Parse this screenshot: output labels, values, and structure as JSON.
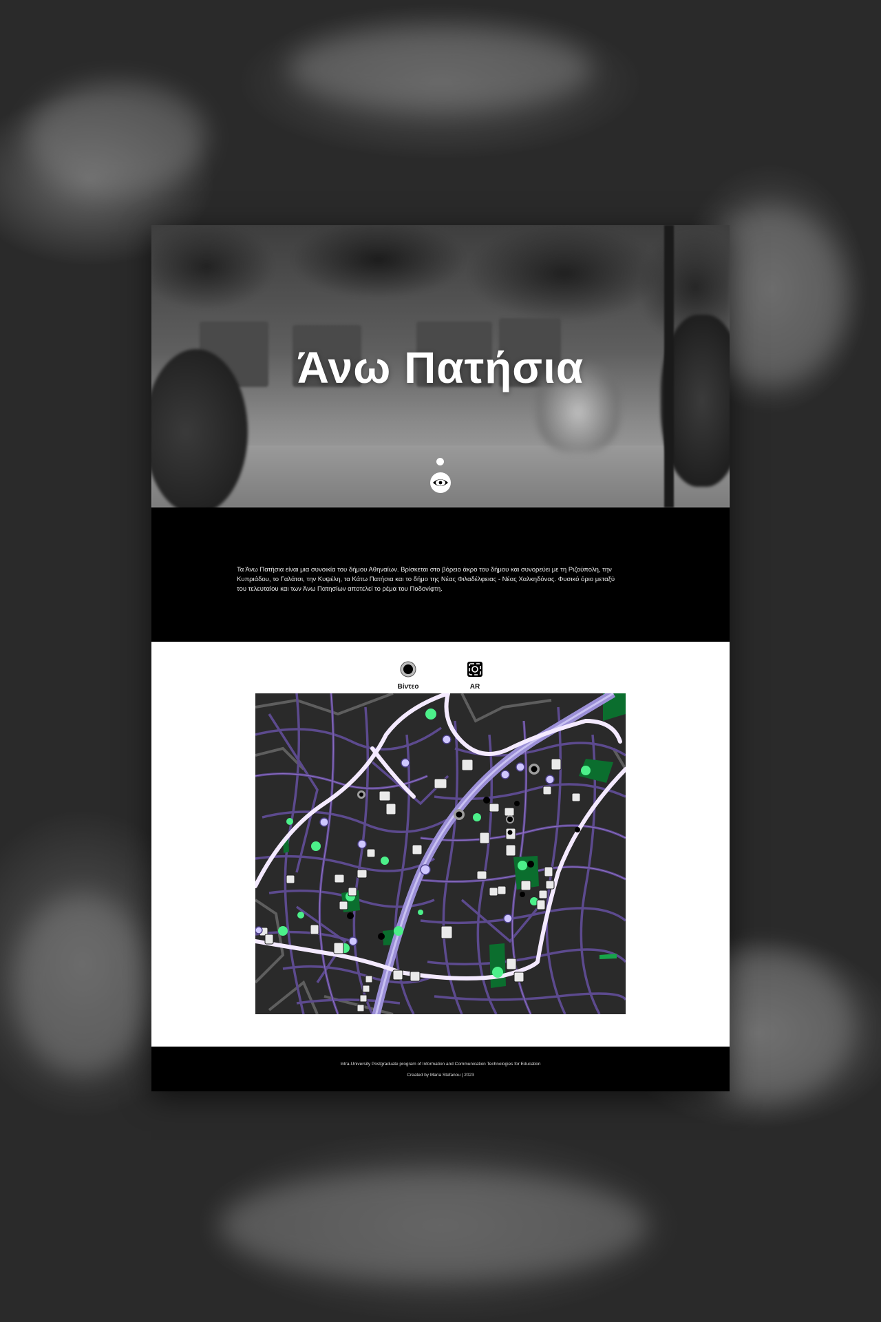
{
  "hero": {
    "title": "Άνω Πατήσια",
    "scroll_icon": "eye-icon"
  },
  "intro": {
    "text": "Τα Άνω Πατήσια είναι μια συνοικία του δήμου Αθηναίων. Βρίσκεται στο βόρειο άκρο του δήμου και συνορεύει με τη Ριζούπολη, την Κυπριάδου, το Γαλάτσι, την Κυψέλη, τα Κάτω Πατήσια και το δήμο της Νέας Φιλαδέλφειας - Νέας Χαλκηδόνας. Φυσικό όριο μεταξύ του τελευταίου και των Άνω Πατησίων αποτελεί το ρέμα του Ποδονίφτη."
  },
  "map_legend": [
    {
      "label": "Βίντεο",
      "icon": "video-marker-icon"
    },
    {
      "label": "AR",
      "icon": "ar-marker-icon"
    }
  ],
  "map": {
    "colors": {
      "background": "#2a2a2a",
      "street": "#5c4a8e",
      "main_road": "#f4eaff",
      "avenue": "#9b8fd6",
      "park": "#17a44a",
      "park_dark": "#0b6e2e"
    }
  },
  "footer": {
    "line1": "Intra-University Postgraduate program of Information and Communication Technologies for Education",
    "line2": "Created by Maria Stefanou | 2023"
  }
}
